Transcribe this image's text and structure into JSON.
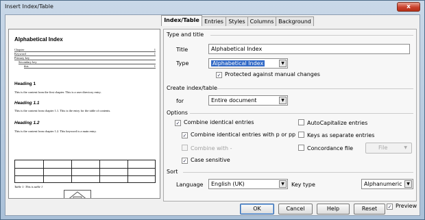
{
  "window": {
    "title": "Insert Index/Table",
    "close_label": "x"
  },
  "preview": {
    "title": "Alphabetical Index",
    "entries": [
      {
        "text": "Chapter",
        "page": "1"
      },
      {
        "text": "Keyword",
        "page": "1"
      },
      {
        "text": "Primary key",
        "page": ""
      },
      {
        "text": "Secondary key",
        "page": ""
      },
      {
        "text": "this",
        "page": "1"
      }
    ],
    "heading1": "Heading 1",
    "text1": "This is the content from the first chapter. This is a user directory entry.",
    "heading11": "Heading 1.1",
    "text11": "This is the content from chapter 1.1. This is the entry for the table of contents.",
    "heading12": "Heading 1.2",
    "text12": "This is the content from chapter 1.2. This keyword is a main entry.",
    "table_caption": "Table 1: This is table 1"
  },
  "tabs": [
    "Index/Table",
    "Entries",
    "Styles",
    "Columns",
    "Background"
  ],
  "type_and_title": {
    "section": "Type and title",
    "title_label": "Title",
    "title_value": "Alphabetical Index",
    "type_label": "Type",
    "type_value": "Alphabetical Index",
    "protected_label": "Protected against manual changes"
  },
  "create": {
    "section": "Create index/table",
    "for_label": "for",
    "for_value": "Entire document"
  },
  "options": {
    "section": "Options",
    "combine_identical": "Combine identical entries",
    "combine_p_pp": "Combine identical entries with p or pp",
    "combine_with": "Combine with -",
    "case_sensitive": "Case sensitive",
    "autocapitalize": "AutoCapitalize entries",
    "keys_separate": "Keys as separate entries",
    "concordance": "Concordance file",
    "file_button": "File"
  },
  "sort": {
    "section": "Sort",
    "language_label": "Language",
    "language_value": "English (UK)",
    "key_type_label": "Key type",
    "key_type_value": "Alphanumeric"
  },
  "buttons": {
    "ok": "OK",
    "cancel": "Cancel",
    "help": "Help",
    "reset": "Reset",
    "preview": "Preview"
  }
}
